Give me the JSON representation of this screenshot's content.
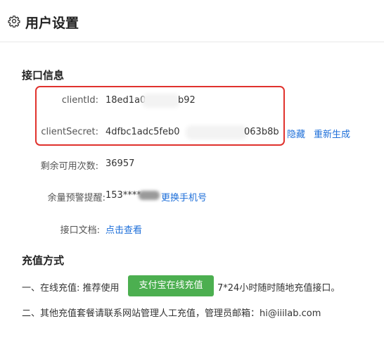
{
  "header": {
    "title": "用户设置",
    "icon": "gear-icon"
  },
  "api_section": {
    "title": "接口信息",
    "client_id": {
      "label": "clientId:",
      "value_start": "18ed1a0",
      "value_end": "b92"
    },
    "client_secret": {
      "label": "clientSecret:",
      "value_start": "4dfbc1adc5feb0",
      "value_end": "063b8b"
    },
    "hide_link": "隐藏",
    "regenerate_link": "重新生成",
    "remaining": {
      "label": "剩余可用次数:",
      "value": "36957"
    },
    "warning": {
      "label": "余量预警提醒:",
      "value": "153****",
      "link": "更换手机号"
    },
    "docs": {
      "label": "接口文档:",
      "link": "点击查看"
    }
  },
  "recharge_section": {
    "title": "充值方式",
    "online_prefix": "一、在线充值: 推荐使用",
    "alipay_button": "支付宝在线充值",
    "online_suffix": "7*24小时随时随地充值接口。",
    "other_text": "二、其他充值套餐请联系网站管理人工充值，管理员邮箱：hi@iiilab.com"
  },
  "colors": {
    "link": "#1e6fd9",
    "highlight_border": "#e0322d",
    "pay_button": "#4caf50"
  }
}
